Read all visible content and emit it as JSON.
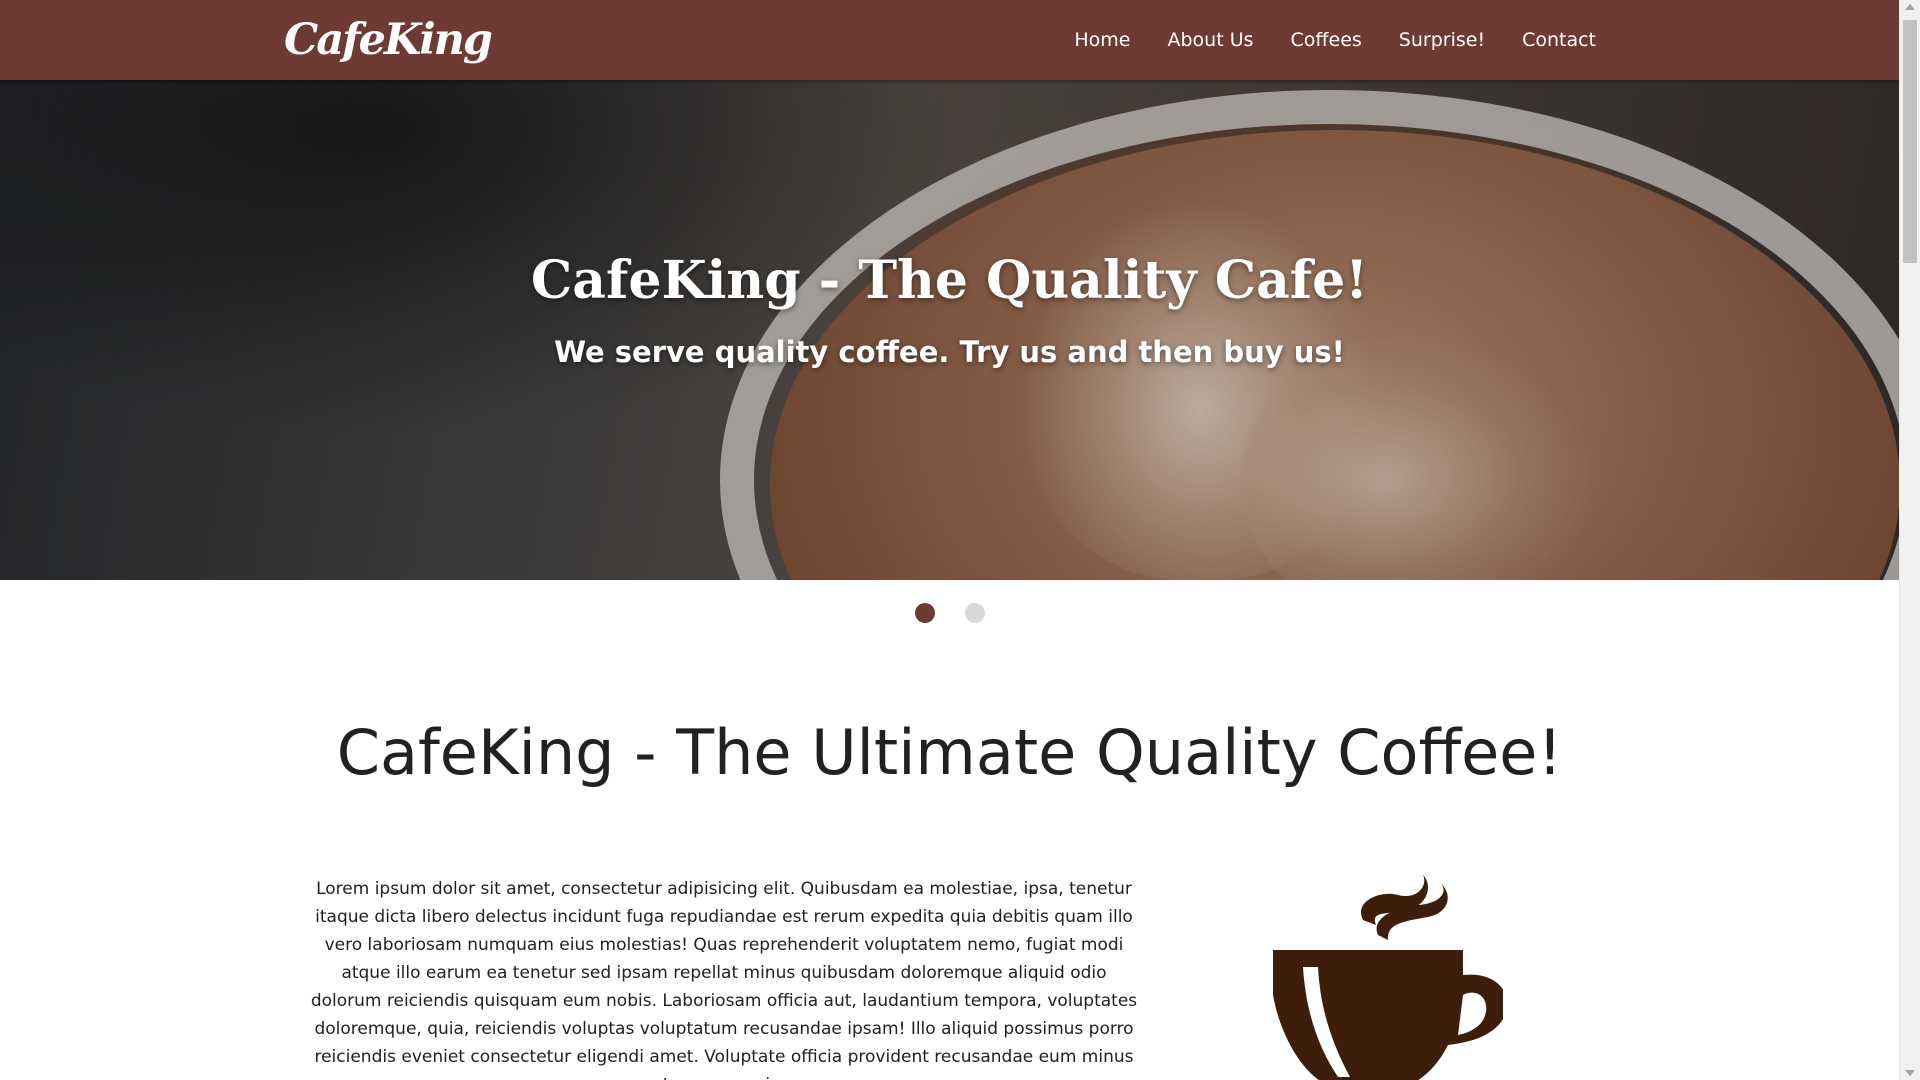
{
  "header": {
    "logo_text": "CafeKing",
    "nav": [
      "Home",
      "About Us",
      "Coffees",
      "Surprise!",
      "Contact"
    ]
  },
  "hero": {
    "title": "CafeKing - The Quality Cafe!",
    "subtitle": "We serve quality coffee. Try us and then buy us!",
    "slides_count": 2,
    "active_slide": 1
  },
  "main": {
    "title": "CafeKing - The Ultimate Quality Coffee!",
    "paragraph": "Lorem ipsum dolor sit amet, consectetur adipisicing elit. Quibusdam ea molestiae, ipsa, tenetur itaque dicta libero delectus incidunt fuga repudiandae est rerum expedita quia debitis quam illo vero laboriosam numquam eius molestias! Quas reprehenderit voluptatem nemo, fugiat modi atque illo earum ea tenetur sed ipsam repellat minus quibusdam doloremque aliquid odio dolorum reiciendis quisquam eum nobis. Laboriosam officia aut, laudantium tempora, voluptates doloremque, quia, reiciendis voluptas voluptatum recusandae ipsam! Illo aliquid possimus porro reiciendis eveniet consectetur eligendi amet. Voluptate officia provident recusandae eum minus aut nam asperiores"
  },
  "colors": {
    "brand": "#6e3b34",
    "cup": "#3f1d0b",
    "dot_inactive": "#d8d8d8"
  },
  "icons": {
    "coffee_cup": "coffee-cup-icon"
  }
}
